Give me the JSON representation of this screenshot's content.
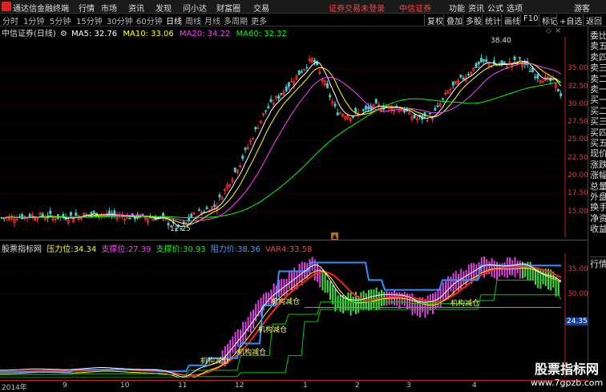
{
  "menubar": {
    "app_name": "通达信金融终端",
    "items": [
      "行情",
      "市场",
      "资讯",
      "发现",
      "问小达",
      "财富圈",
      "交易"
    ],
    "login_note": "证券交易未登录",
    "broker": "中信证券",
    "right_items": [
      "功能",
      "资讯",
      "公式",
      "选项"
    ],
    "user": "游客"
  },
  "periodbar": {
    "periods": [
      "分时",
      "1分钟",
      "5分钟",
      "15分钟",
      "30分钟",
      "60分钟",
      "日线",
      "周线",
      "月线",
      "多周期",
      "更多"
    ],
    "active": "日线",
    "tools": [
      "复权",
      "叠加",
      "多股",
      "统计",
      "画线",
      "F10",
      "标记",
      "+自选",
      "返回"
    ]
  },
  "main_chart": {
    "title": "中信证券(日线)",
    "ma": [
      {
        "label": "MA5: 32.76",
        "color": "#ffffff"
      },
      {
        "label": "MA10: 33.06",
        "color": "#ffff00"
      },
      {
        "label": "MA20: 34.22",
        "color": "#ff00ff"
      },
      {
        "label": "MA60: 32.32",
        "color": "#00ff00"
      }
    ],
    "high_label": "38.40",
    "low_label": "12.25",
    "y_ticks": [
      "35.00",
      "32.50",
      "30.00",
      "27.50",
      "25.00",
      "22.50",
      "20.00",
      "17.50",
      "15.00"
    ]
  },
  "indicator": {
    "name": "股票指标网",
    "fields": [
      {
        "label": "压力位:",
        "value": "34.34",
        "color": "#ffff00"
      },
      {
        "label": "支撑位:",
        "value": "27.39",
        "color": "#ff40ff"
      },
      {
        "label": "支撑价:",
        "value": "30.93",
        "color": "#00ff00"
      },
      {
        "label": "阻力价:",
        "value": "38.36",
        "color": "#40a0ff"
      },
      {
        "label": "VAR4:",
        "value": "33.58",
        "color": "#ff4040"
      }
    ],
    "annotations": [
      "机构减仓",
      "机构减仓",
      "机构减仓",
      "机构减仓",
      "机构减仓"
    ],
    "y_ticks": [
      "35.00",
      "30.00",
      "24.35"
    ]
  },
  "x_axis": [
    "2014年",
    "9",
    "10",
    "11",
    "12",
    "1",
    "2",
    "3",
    "4"
  ],
  "side_panel": [
    "委比",
    "卖五",
    "卖四",
    "卖三",
    "卖二",
    "卖一",
    "买一",
    "买二",
    "买三",
    "买四",
    "买五",
    "现价",
    "涨跌",
    "涨幅",
    "总量",
    "外盘",
    "换手",
    "净资",
    "收益"
  ],
  "side_bottom": [
    "行情"
  ],
  "watermark": {
    "title": "股票指标网",
    "url": "www.7gpzb.com"
  }
}
